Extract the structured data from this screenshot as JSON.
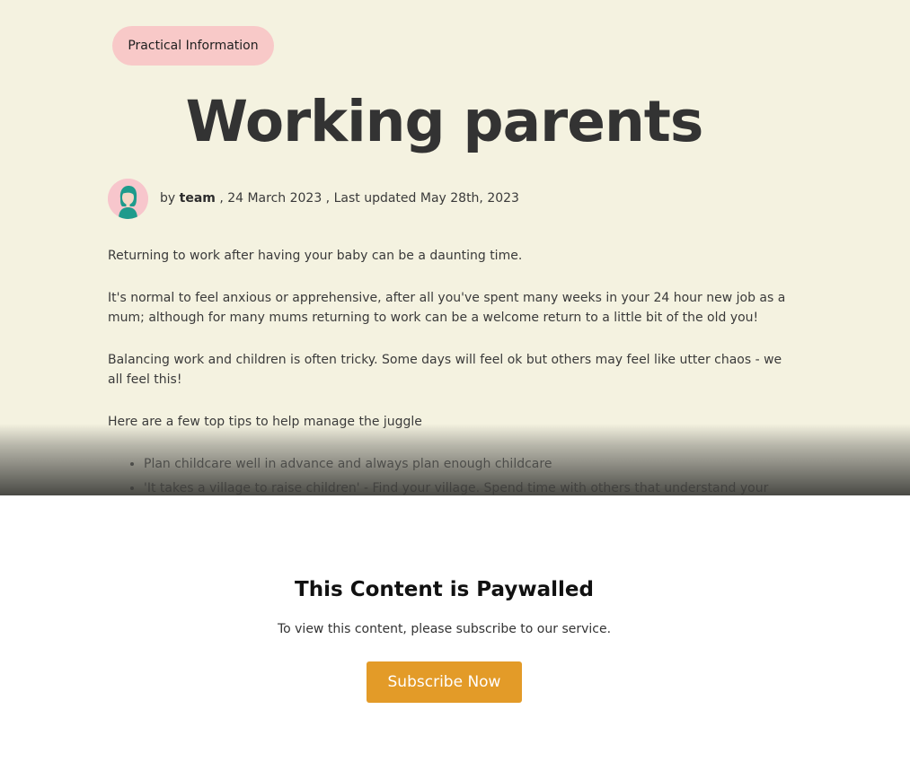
{
  "article": {
    "category": "Practical Information",
    "title": "Working parents",
    "byline": {
      "prefix": "by",
      "author": "team",
      "date_part": ", 24 March 2023 , Last updated May 28th, 2023"
    },
    "paragraphs": [
      "Returning to work after having your baby can be a daunting time.",
      "It's normal to feel anxious or apprehensive, after all you've spent many weeks in your 24 hour new job as a mum; although for many mums returning to work can be a welcome return to a little bit of the old you!",
      "Balancing work and children is often tricky. Some days will feel ok but others may feel like utter chaos - we all feel this!",
      "Here are a few top tips to help manage the juggle"
    ],
    "tips": [
      "Plan childcare well in advance and always plan enough childcare",
      "'It takes a village to raise children' - Find your village. Spend time with others that understand your"
    ]
  },
  "paywall": {
    "title": "This Content is Paywalled",
    "message": "To view this content, please subscribe to our service.",
    "button_label": "Subscribe Now"
  },
  "icons": {
    "avatar": "author-avatar-illustration"
  },
  "colors": {
    "article_background": "#f4f2e0",
    "category_pill": "#f8c9c8",
    "title_text": "#333333",
    "subscribe_button": "#e39b28",
    "avatar_hair": "#1e9b8c"
  }
}
